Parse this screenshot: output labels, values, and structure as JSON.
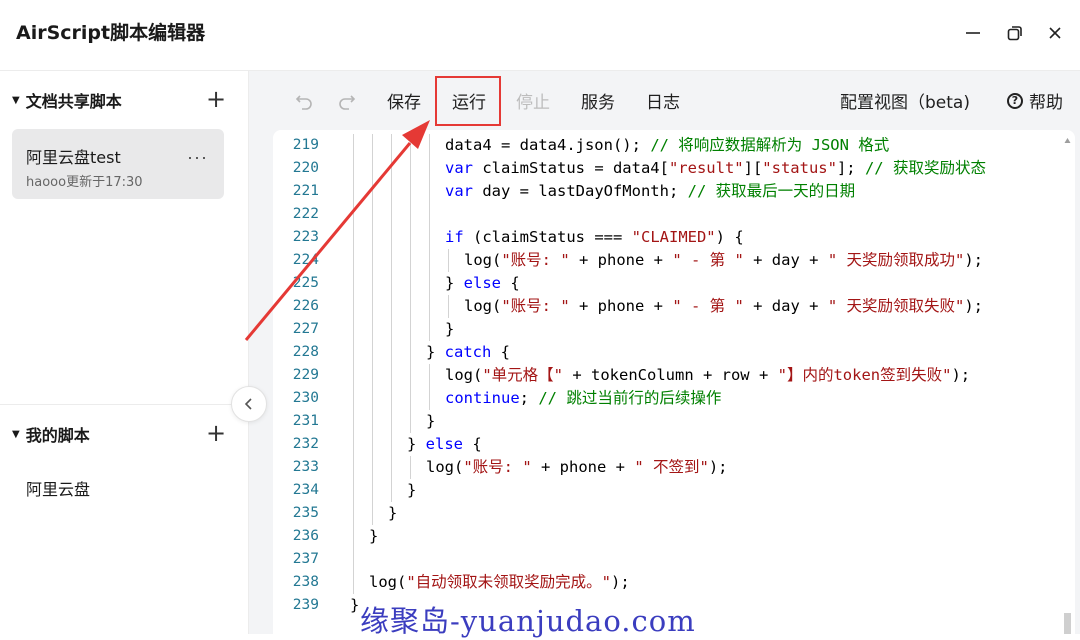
{
  "window": {
    "title": "AirScript脚本编辑器",
    "controls": [
      "minimize-icon",
      "restore-icon",
      "close-icon"
    ]
  },
  "sidebar": {
    "shared_section": {
      "title": "文档共享脚本",
      "items": [
        {
          "name": "阿里云盘test",
          "meta": "haooo更新于17:30"
        }
      ]
    },
    "my_section": {
      "title": "我的脚本",
      "items": [
        {
          "name": "阿里云盘"
        }
      ]
    }
  },
  "toolbar": {
    "undo": "undo-icon",
    "redo": "redo-icon",
    "save": "保存",
    "run": "运行",
    "stop": "停止",
    "service": "服务",
    "log": "日志",
    "config_view": "配置视图（beta)",
    "help": "帮助"
  },
  "editor": {
    "lines": [
      {
        "n": "219",
        "indent": 5,
        "tokens": [
          [
            "p",
            "data4 = data4.json(); "
          ],
          [
            "c",
            "// 将响应数据解析为 JSON 格式"
          ]
        ]
      },
      {
        "n": "220",
        "indent": 5,
        "tokens": [
          [
            "k",
            "var"
          ],
          [
            "p",
            " claimStatus = data4["
          ],
          [
            "s",
            "\"result\""
          ],
          [
            "p",
            "]["
          ],
          [
            "s",
            "\"status\""
          ],
          [
            "p",
            "]; "
          ],
          [
            "c",
            "// 获取奖励状态"
          ]
        ]
      },
      {
        "n": "221",
        "indent": 5,
        "tokens": [
          [
            "k",
            "var"
          ],
          [
            "p",
            " day = lastDayOfMonth; "
          ],
          [
            "c",
            "// 获取最后一天的日期"
          ]
        ]
      },
      {
        "n": "222",
        "indent": 5,
        "tokens": []
      },
      {
        "n": "223",
        "indent": 5,
        "tokens": [
          [
            "k",
            "if"
          ],
          [
            "p",
            " (claimStatus === "
          ],
          [
            "s",
            "\"CLAIMED\""
          ],
          [
            "p",
            ") {"
          ]
        ]
      },
      {
        "n": "224",
        "indent": 6,
        "tokens": [
          [
            "p",
            "log("
          ],
          [
            "s",
            "\"账号: \""
          ],
          [
            "p",
            " + phone + "
          ],
          [
            "s",
            "\" - 第 \""
          ],
          [
            "p",
            " + day + "
          ],
          [
            "s",
            "\" 天奖励领取成功\""
          ],
          [
            "p",
            ");"
          ]
        ]
      },
      {
        "n": "225",
        "indent": 5,
        "tokens": [
          [
            "p",
            "} "
          ],
          [
            "k",
            "else"
          ],
          [
            "p",
            " {"
          ]
        ]
      },
      {
        "n": "226",
        "indent": 6,
        "tokens": [
          [
            "p",
            "log("
          ],
          [
            "s",
            "\"账号: \""
          ],
          [
            "p",
            " + phone + "
          ],
          [
            "s",
            "\" - 第 \""
          ],
          [
            "p",
            " + day + "
          ],
          [
            "s",
            "\" 天奖励领取失败\""
          ],
          [
            "p",
            ");"
          ]
        ]
      },
      {
        "n": "227",
        "indent": 5,
        "tokens": [
          [
            "p",
            "}"
          ]
        ]
      },
      {
        "n": "228",
        "indent": 4,
        "tokens": [
          [
            "p",
            "} "
          ],
          [
            "k",
            "catch"
          ],
          [
            "p",
            " {"
          ]
        ]
      },
      {
        "n": "229",
        "indent": 5,
        "tokens": [
          [
            "p",
            "log("
          ],
          [
            "s",
            "\"单元格【\""
          ],
          [
            "p",
            " + tokenColumn + row + "
          ],
          [
            "s",
            "\"】内的token签到失败\""
          ],
          [
            "p",
            ");"
          ]
        ]
      },
      {
        "n": "230",
        "indent": 5,
        "tokens": [
          [
            "k",
            "continue"
          ],
          [
            "p",
            "; "
          ],
          [
            "c",
            "// 跳过当前行的后续操作"
          ]
        ]
      },
      {
        "n": "231",
        "indent": 4,
        "tokens": [
          [
            "p",
            "}"
          ]
        ]
      },
      {
        "n": "232",
        "indent": 3,
        "tokens": [
          [
            "p",
            "} "
          ],
          [
            "k",
            "else"
          ],
          [
            "p",
            " {"
          ]
        ]
      },
      {
        "n": "233",
        "indent": 4,
        "tokens": [
          [
            "p",
            "log("
          ],
          [
            "s",
            "\"账号: \""
          ],
          [
            "p",
            " + phone + "
          ],
          [
            "s",
            "\" 不签到\""
          ],
          [
            "p",
            ");"
          ]
        ]
      },
      {
        "n": "234",
        "indent": 3,
        "tokens": [
          [
            "p",
            "}"
          ]
        ]
      },
      {
        "n": "235",
        "indent": 2,
        "tokens": [
          [
            "p",
            "}"
          ]
        ]
      },
      {
        "n": "236",
        "indent": 1,
        "tokens": [
          [
            "p",
            "}"
          ]
        ]
      },
      {
        "n": "237",
        "indent": 1,
        "tokens": []
      },
      {
        "n": "238",
        "indent": 1,
        "tokens": [
          [
            "p",
            "log("
          ],
          [
            "s",
            "\"自动领取未领取奖励完成。\""
          ],
          [
            "p",
            ");"
          ]
        ]
      },
      {
        "n": "239",
        "indent": 0,
        "tokens": [
          [
            "p",
            "}"
          ]
        ]
      }
    ]
  },
  "watermark": "缘聚岛-yuanjudao.com",
  "colors": {
    "keyword": "#0000ff",
    "string": "#a31515",
    "comment": "#008000",
    "line_number": "#237893",
    "highlight_box": "#e53935",
    "arrow": "#e53935"
  }
}
